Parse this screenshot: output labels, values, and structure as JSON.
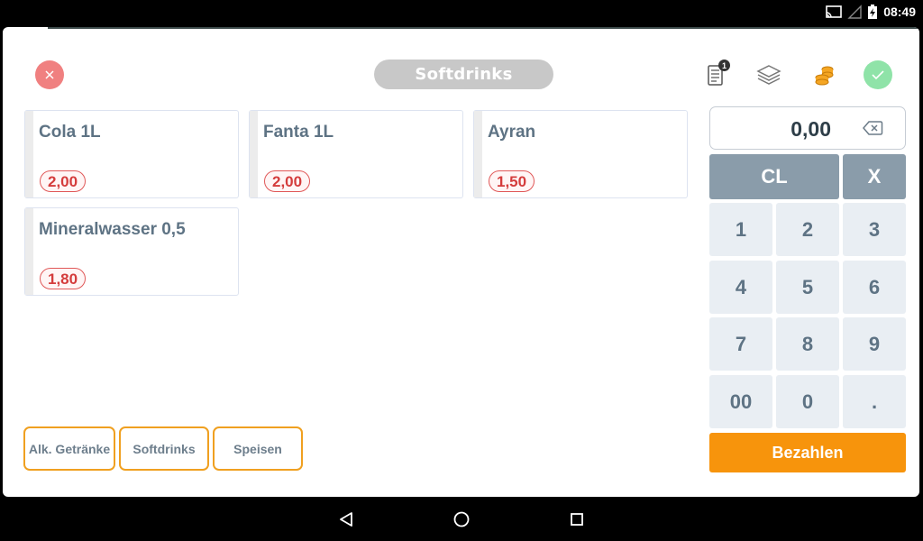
{
  "status_bar": {
    "time": "08:49",
    "icons": [
      "cast-icon",
      "signal-icon",
      "battery-charging-icon"
    ]
  },
  "header": {
    "title": "Softdrinks",
    "close_icon": "close-icon",
    "receipt_icon": "receipt-icon",
    "receipt_badge": "1",
    "layers_icon": "layers-icon",
    "coins_icon": "coins-icon",
    "confirm_icon": "check-icon"
  },
  "products": [
    {
      "name": "Cola 1L",
      "price": "2,00"
    },
    {
      "name": "Fanta 1L",
      "price": "2,00"
    },
    {
      "name": "Ayran",
      "price": "1,50"
    },
    {
      "name": "Mineralwasser 0,5",
      "price": "1,80"
    }
  ],
  "categories": [
    {
      "label": "Alk. Getränke"
    },
    {
      "label": "Softdrinks"
    },
    {
      "label": "Speisen"
    }
  ],
  "keypad": {
    "display_value": "0,00",
    "clear_label": "CL",
    "multiply_label": "X",
    "keys": [
      "1",
      "2",
      "3",
      "4",
      "5",
      "6",
      "7",
      "8",
      "9",
      "00",
      "0",
      "."
    ],
    "pay_label": "Bezahlen"
  },
  "colors": {
    "accent_orange": "#f7940c",
    "price_red": "#d43c3c",
    "close_red": "#f08080",
    "confirm_green": "#8fe3a8",
    "text_slate": "#5e7384",
    "key_bg": "#e9eef3",
    "key_dark": "#8a9caa"
  },
  "nav_bar": {
    "icons": [
      "back-icon",
      "home-icon",
      "recents-icon"
    ]
  }
}
